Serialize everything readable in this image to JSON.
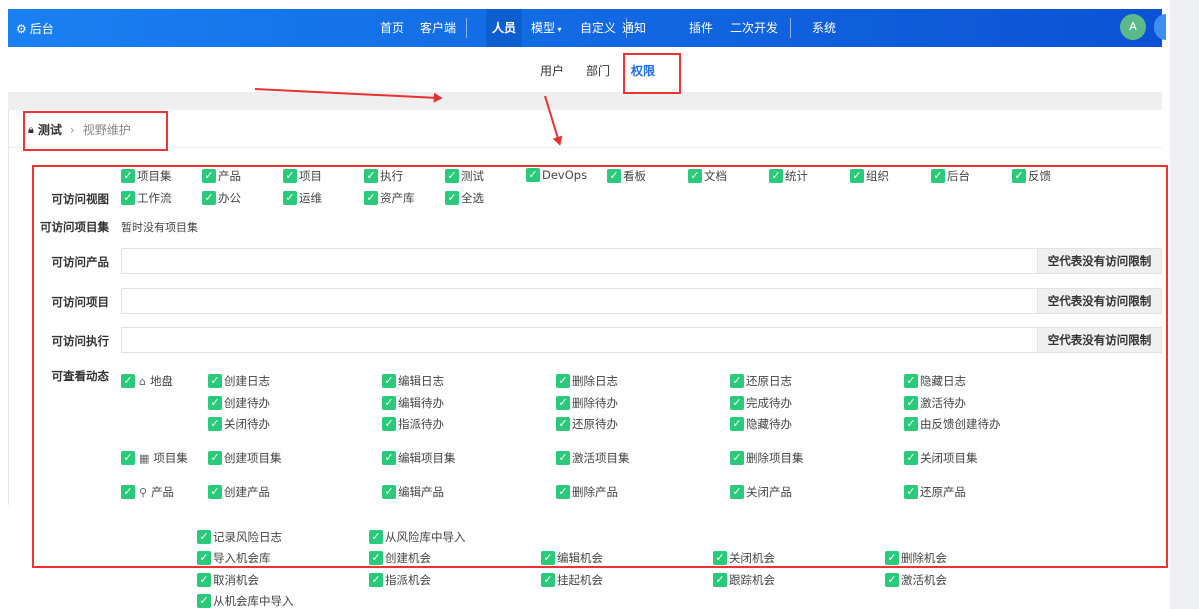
{
  "nav": {
    "brand": "后台",
    "items": [
      "首页",
      "客户端",
      "人员",
      "模型",
      "自定义",
      "通知",
      "插件",
      "二次开发",
      "系统"
    ],
    "active": "人员",
    "avatar": "A"
  },
  "subnav": {
    "items": [
      "用户",
      "部门",
      "权限"
    ],
    "active": "权限"
  },
  "breadcrumb": {
    "group": "测试",
    "current": "视野维护"
  },
  "views": {
    "label": "可访问视图",
    "items": [
      "项目集",
      "产品",
      "项目",
      "执行",
      "测试",
      "DevOps",
      "看板",
      "文档",
      "统计",
      "组织",
      "后台",
      "反馈",
      "工作流",
      "办公",
      "运维",
      "资产库",
      "全选"
    ]
  },
  "programs": {
    "label": "可访问项目集",
    "value": "暂时没有项目集"
  },
  "limits": [
    {
      "label": "可访问产品",
      "button": "空代表没有访问限制"
    },
    {
      "label": "可访问项目",
      "button": "空代表没有访问限制"
    },
    {
      "label": "可访问执行",
      "button": "空代表没有访问限制"
    }
  ],
  "dynamics": {
    "label": "可查看动态",
    "groups": [
      {
        "name": "地盘",
        "icon": "home-icon",
        "items": [
          "创建日志",
          "编辑日志",
          "删除日志",
          "还原日志",
          "隐藏日志",
          "创建待办",
          "编辑待办",
          "删除待办",
          "完成待办",
          "激活待办",
          "关闭待办",
          "指派待办",
          "还原待办",
          "隐藏待办",
          "由反馈创建待办"
        ]
      },
      {
        "name": "项目集",
        "icon": "grid-icon",
        "items": [
          "创建项目集",
          "编辑项目集",
          "激活项目集",
          "删除项目集",
          "关闭项目集"
        ]
      },
      {
        "name": "产品",
        "icon": "lightbulb-icon",
        "items": [
          "创建产品",
          "编辑产品",
          "删除产品",
          "关闭产品",
          "还原产品"
        ]
      }
    ],
    "extra": [
      [
        "记录风险日志",
        "从风险库中导入"
      ],
      [
        "导入机会库",
        "创建机会",
        "编辑机会",
        "关闭机会",
        "删除机会"
      ],
      [
        "取消机会",
        "指派机会",
        "挂起机会",
        "跟踪机会",
        "激活机会"
      ],
      [
        "从机会库中导入"
      ]
    ]
  },
  "colors": {
    "nav": "#1a80f2",
    "check": "#2bc97a",
    "accent": "#1a6ef0",
    "annotation": "#ee3333"
  }
}
